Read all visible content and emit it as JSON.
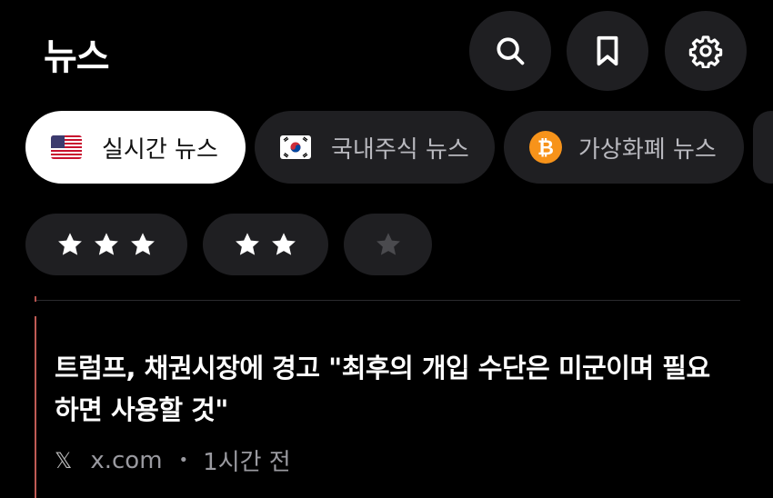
{
  "header": {
    "title": "뉴스",
    "icons": [
      "search-icon",
      "bookmark-icon",
      "gear-icon"
    ]
  },
  "tabs": [
    {
      "label": "실시간 뉴스",
      "icon": "us-flag-icon",
      "active": true
    },
    {
      "label": "국내주식 뉴스",
      "icon": "kr-flag-icon",
      "active": false
    },
    {
      "label": "가상화폐 뉴스",
      "icon": "bitcoin-icon",
      "active": false
    }
  ],
  "star_filters": [
    {
      "stars": 3,
      "active_color": "#ffffff"
    },
    {
      "stars": 2,
      "active_color": "#ffffff"
    },
    {
      "stars": 1,
      "active_color": "#4a4a4e"
    }
  ],
  "news": [
    {
      "headline": "트럼프, 채권시장에 경고 \"최후의 개입 수단은 미군이며 필요하면 사용할 것\"",
      "source_icon": "x-logo-icon",
      "source": "x.com",
      "separator": "•",
      "time": "1시간 전"
    }
  ],
  "colors": {
    "background": "#000000",
    "pill": "#1f1f22",
    "accent_bar": "#c05b55",
    "bitcoin": "#f7931a"
  }
}
